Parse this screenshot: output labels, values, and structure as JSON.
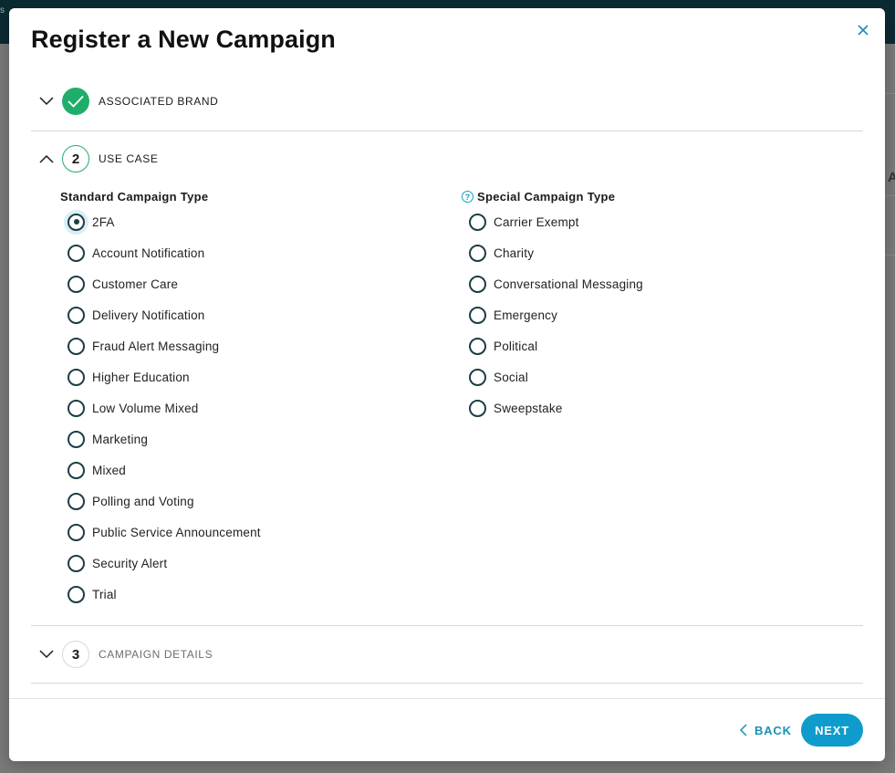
{
  "backdrop": {
    "fragment": "s",
    "right_letter": "A"
  },
  "modal": {
    "title": "Register a New Campaign",
    "close_icon": "close-icon"
  },
  "steps": [
    {
      "number": "",
      "label": "ASSOCIATED BRAND",
      "state": "done",
      "icon": "check-icon"
    },
    {
      "number": "2",
      "label": "USE CASE",
      "state": "active"
    },
    {
      "number": "3",
      "label": "CAMPAIGN DETAILS",
      "state": "pending"
    }
  ],
  "use_case": {
    "standard": {
      "heading": "Standard Campaign Type",
      "selected": "2FA",
      "options": [
        "2FA",
        "Account Notification",
        "Customer Care",
        "Delivery Notification",
        "Fraud Alert Messaging",
        "Higher Education",
        "Low Volume Mixed",
        "Marketing",
        "Mixed",
        "Polling and Voting",
        "Public Service Announcement",
        "Security Alert",
        "Trial"
      ]
    },
    "special": {
      "heading": "Special Campaign Type",
      "help_icon": "?",
      "options": [
        "Carrier Exempt",
        "Charity",
        "Conversational Messaging",
        "Emergency",
        "Political",
        "Social",
        "Sweepstake"
      ]
    }
  },
  "footer": {
    "back_label": "BACK",
    "next_label": "NEXT"
  },
  "colors": {
    "accent": "#0f9ccd",
    "success": "#1fae6a",
    "radio": "#1d3d47"
  }
}
